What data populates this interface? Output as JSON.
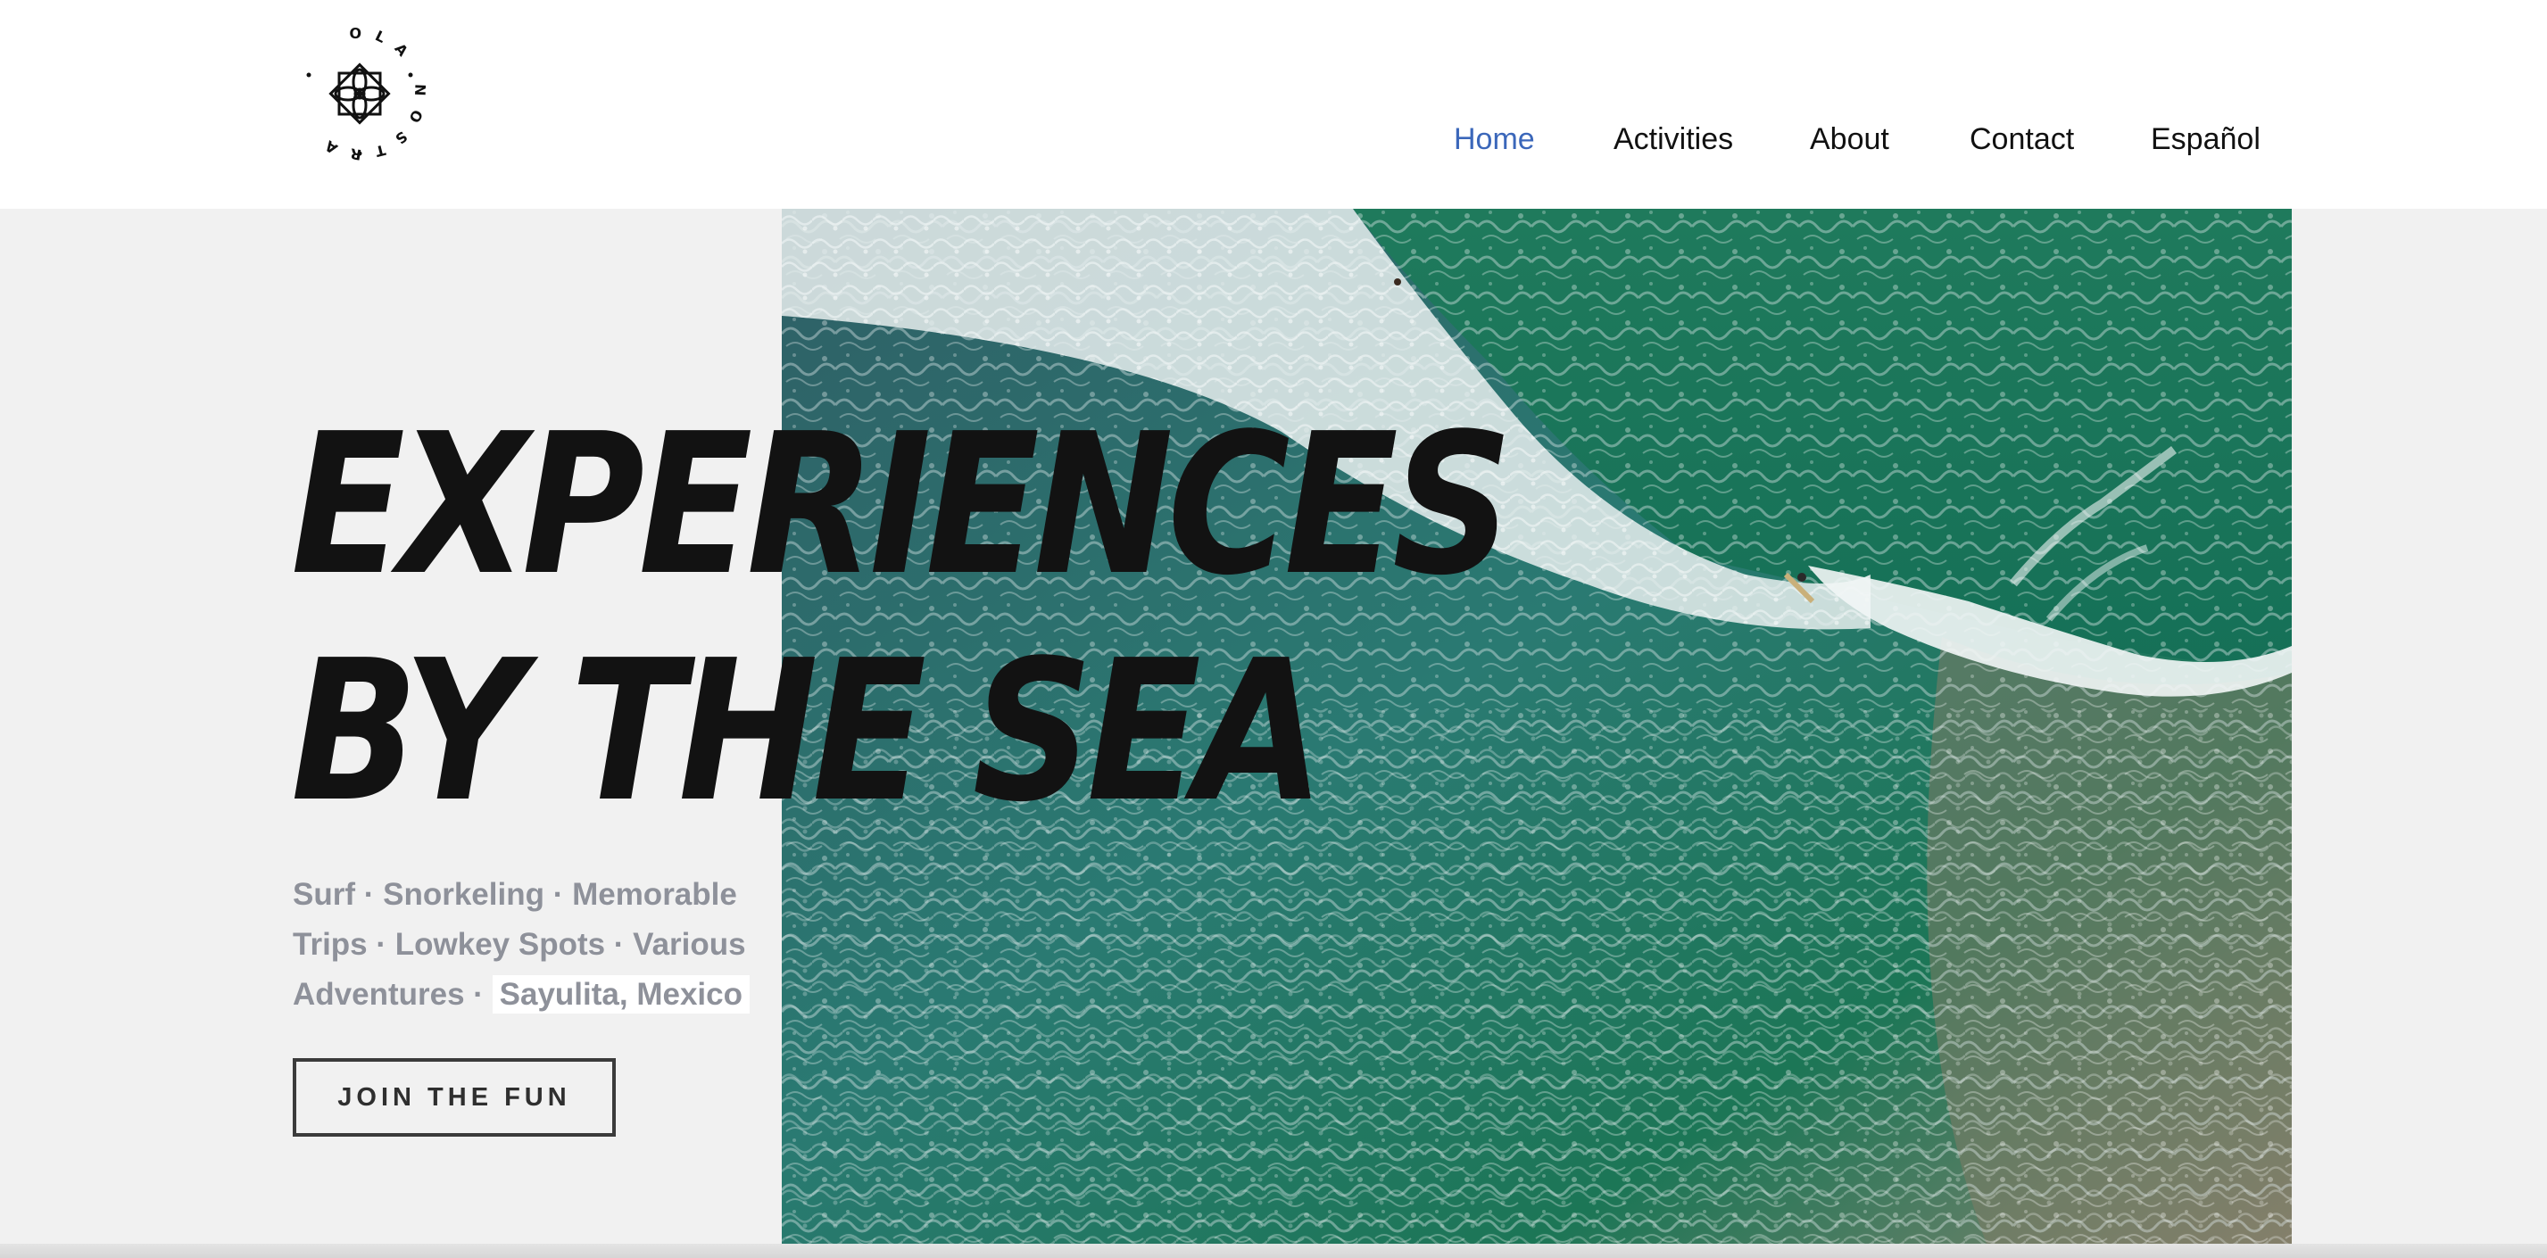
{
  "header": {
    "logo": {
      "icon": "lotus-icon",
      "ring_text": "OLA NOSTRA"
    },
    "nav": [
      {
        "label": "Home",
        "active": true
      },
      {
        "label": "Activities",
        "active": false
      },
      {
        "label": "About",
        "active": false
      },
      {
        "label": "Contact",
        "active": false
      },
      {
        "label": "Español",
        "active": false
      }
    ]
  },
  "hero": {
    "headline_line1": "EXPERIENCES",
    "headline_line2": "BY THE SEA",
    "tagline_main": "Surf · Snorkeling · Memorable Trips · Lowkey Spots · Various Adventures · ",
    "tagline_highlight": "Sayulita, Mexico",
    "cta_label": "JOIN THE FUN",
    "image": "aerial-ocean-waves-surfer"
  },
  "colors": {
    "nav_active": "#3b67ba",
    "headline": "#121212",
    "tagline": "#8e919a",
    "background": "#f1f1f1",
    "ocean": "#1d7a5c"
  }
}
